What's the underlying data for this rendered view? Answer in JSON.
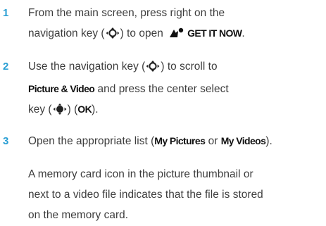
{
  "steps": [
    {
      "number": "1",
      "line1": "From the main screen, press right on the",
      "line2_pre": "navigation key (",
      "line2_mid": ") to open ",
      "get_it_now": "GET IT NOW",
      "line2_end": "."
    },
    {
      "number": "2",
      "line1_pre": "Use the navigation key (",
      "line1_post": ") to scroll to",
      "picture_video": "Picture & Video",
      "line2_post": " and press the center select",
      "line3_pre": "key (",
      "line3_mid1": ") (",
      "ok": "OK",
      "line3_end": ")."
    },
    {
      "number": "3",
      "pre": "Open the appropriate list (",
      "my_pictures": "My Pictures",
      "or": " or ",
      "my_videos": "My Videos",
      "post": ")."
    }
  ],
  "note": {
    "line1": "A memory card icon in the picture thumbnail or",
    "line2": "next to a video file indicates that the file is stored",
    "line3": "on the memory card."
  },
  "colors": {
    "step_number": "#2a9fd4",
    "text": "#3c3c3c",
    "emphasis": "#111111"
  },
  "icons": [
    "navigation-key-icon",
    "center-select-key-icon",
    "get-it-now-icon"
  ]
}
